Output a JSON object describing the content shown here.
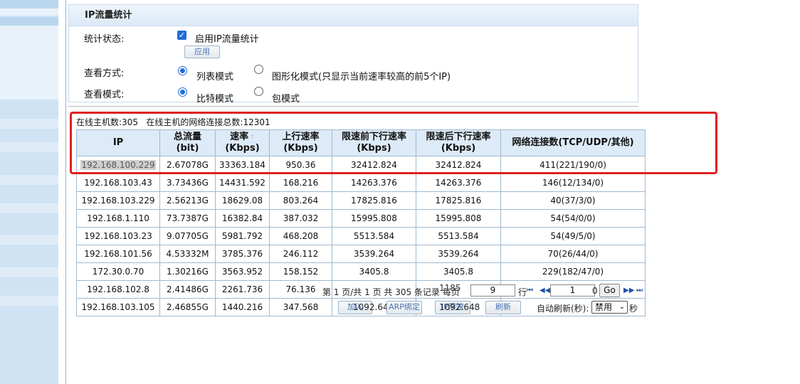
{
  "panel": {
    "title": "IP流量统计",
    "stat_status_label": "统计状态:",
    "enable_label": "启用IP流量统计",
    "apply_label": "应用",
    "view_mode_label": "查看方式:",
    "view_list_label": "列表模式",
    "view_graph_label": "图形化模式(只显示当前速率较高的前5个IP)",
    "view_unit_label": "查看模式:",
    "unit_bit_label": "比特模式",
    "unit_packet_label": "包模式"
  },
  "summary": {
    "online_hosts": "在线主机数:305",
    "connections": "在线主机的网络连接总数:12301"
  },
  "table": {
    "headers": [
      "IP",
      "总流量\n(bit)",
      "速率\n(Kbps)",
      "上行速率\n(Kbps)",
      "限速前下行速率\n(Kbps)",
      "限速后下行速率\n(Kbps)",
      "网络连接数(TCP/UDP/其他)"
    ],
    "rows": [
      [
        "192.168.100.229",
        "2.67078G",
        "33363.184",
        "950.36",
        "32412.824",
        "32412.824",
        "411(221/190/0)"
      ],
      [
        "192.168.103.43",
        "3.73436G",
        "14431.592",
        "168.216",
        "14263.376",
        "14263.376",
        "146(12/134/0)"
      ],
      [
        "192.168.103.229",
        "2.56213G",
        "18629.08",
        "803.264",
        "17825.816",
        "17825.816",
        "40(37/3/0)"
      ],
      [
        "192.168.1.110",
        "73.7387G",
        "16382.84",
        "387.032",
        "15995.808",
        "15995.808",
        "54(54/0/0)"
      ],
      [
        "192.168.103.23",
        "9.07705G",
        "5981.792",
        "468.208",
        "5513.584",
        "5513.584",
        "54(49/5/0)"
      ],
      [
        "192.168.101.56",
        "4.53332M",
        "3785.376",
        "246.112",
        "3539.264",
        "3539.264",
        "70(26/44/0)"
      ],
      [
        "172.30.0.70",
        "1.30216G",
        "3563.952",
        "158.152",
        "3405.8",
        "3405.8",
        "229(182/47/0)"
      ],
      [
        "192.168.102.8",
        "2.41486G",
        "2261.736",
        "76.136",
        "",
        "",
        ""
      ],
      [
        "192.168.103.105",
        "2.46855G",
        "1440.216",
        "347.568",
        "",
        "",
        ""
      ]
    ]
  },
  "pager": {
    "text": "第 1 页/共 1 页 共 305 条记录 每页",
    "per_page": "9",
    "rows_suffix": "行",
    "page_value": "1",
    "go_label": "Go",
    "first_icon": "first-page-icon",
    "prev_icon": "prev-page-icon",
    "next_icon": "next-page-icon",
    "last_icon": "last-page-icon"
  },
  "footer": {
    "add_label": "加入",
    "add_overlap": "1092.648",
    "arp_label": "ARP绑定",
    "ip_label": "IP限速",
    "ip_overlap": "1092.648",
    "refresh_label": "刷新",
    "auto_refresh_label": "自动刷新(秒):",
    "auto_refresh_value": "禁用",
    "seconds_label": "秒",
    "overlap_a": "1185",
    "overlap_b": "0"
  },
  "colors": {
    "highlight_border": "#e02020",
    "header_bg": "#ddeaf7",
    "accent": "#1f6fd6"
  }
}
